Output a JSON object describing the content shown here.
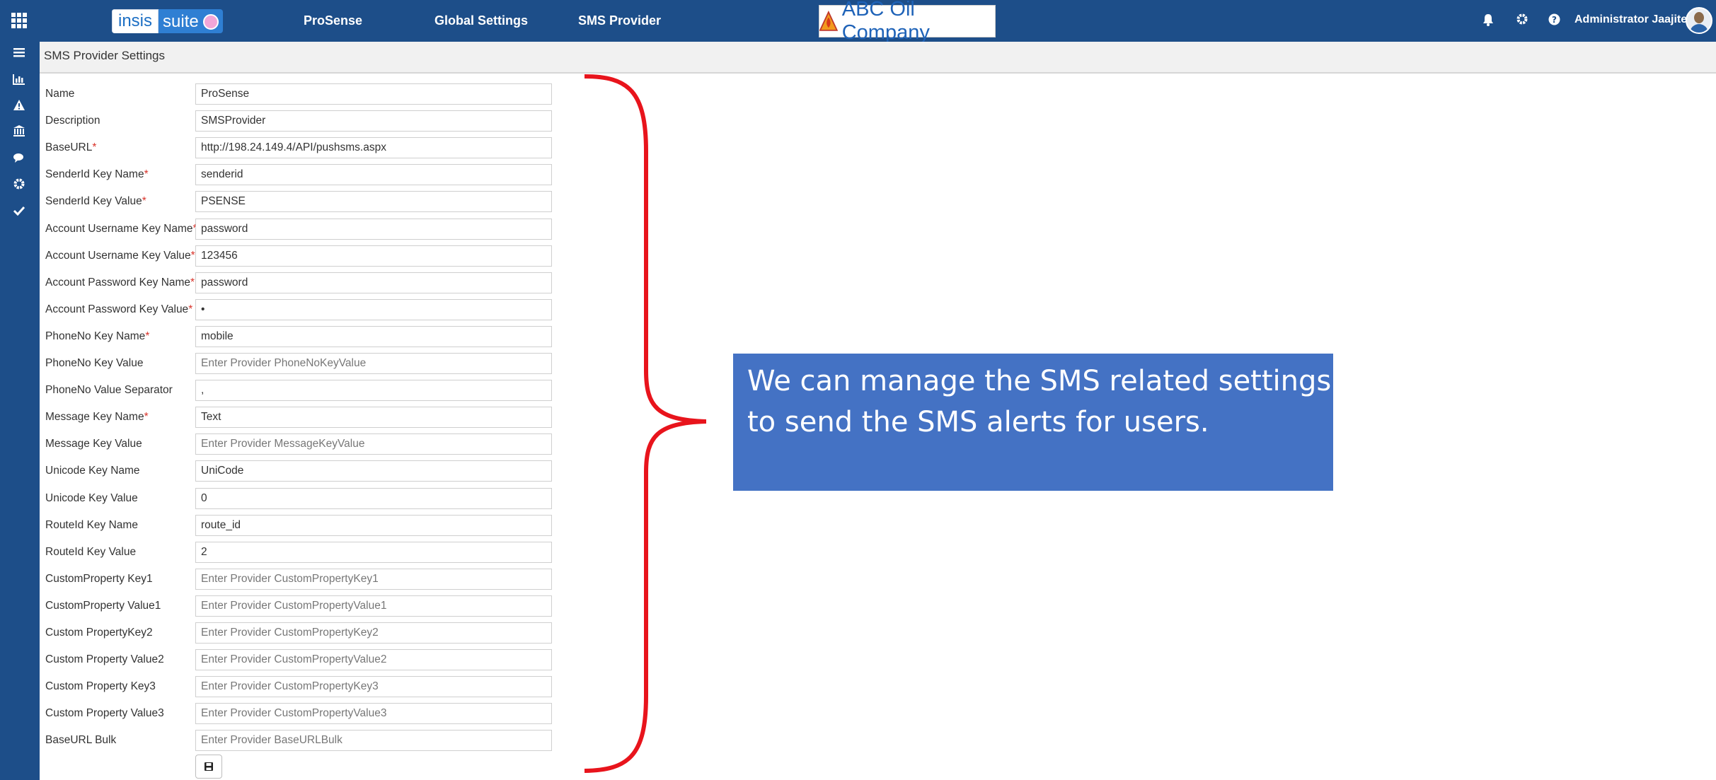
{
  "header": {
    "brand_left": "insis",
    "brand_right": "suite",
    "nav": [
      "ProSense",
      "Global Settings",
      "SMS Provider"
    ],
    "company": "ABC Oil Company",
    "user": "Administrator Jaajitech",
    "icons": [
      "grid-icon",
      "bell-icon",
      "gear-icon",
      "help-icon"
    ]
  },
  "sidebar": {
    "icons": [
      "menu-icon",
      "bar-chart-icon",
      "warning-icon",
      "bank-icon",
      "chat-icon",
      "gear-icon",
      "check-icon"
    ]
  },
  "page": {
    "title": "SMS Provider Settings"
  },
  "form": {
    "rows": [
      {
        "label": "Name",
        "required": false,
        "value": "ProSense",
        "placeholder": ""
      },
      {
        "label": "Description",
        "required": false,
        "value": "SMSProvider",
        "placeholder": ""
      },
      {
        "label": "BaseURL",
        "required": true,
        "value": "http://198.24.149.4/API/pushsms.aspx",
        "placeholder": ""
      },
      {
        "label": "SenderId Key Name",
        "required": true,
        "value": "senderid",
        "placeholder": ""
      },
      {
        "label": "SenderId Key Value",
        "required": true,
        "value": "PSENSE",
        "placeholder": ""
      },
      {
        "label": "Account Username Key Name",
        "required": true,
        "value": "password",
        "placeholder": ""
      },
      {
        "label": "Account Username Key Value",
        "required": true,
        "value": "123456",
        "placeholder": ""
      },
      {
        "label": "Account Password Key Name",
        "required": true,
        "value": "password",
        "placeholder": ""
      },
      {
        "label": "Account Password Key Value",
        "required": true,
        "value": "•",
        "placeholder": ""
      },
      {
        "label": "PhoneNo Key Name",
        "required": true,
        "value": "mobile",
        "placeholder": ""
      },
      {
        "label": "PhoneNo Key Value",
        "required": false,
        "value": "",
        "placeholder": "Enter Provider PhoneNoKeyValue"
      },
      {
        "label": "PhoneNo Value Separator",
        "required": false,
        "value": ",",
        "placeholder": ""
      },
      {
        "label": "Message Key Name",
        "required": true,
        "value": "Text",
        "placeholder": ""
      },
      {
        "label": "Message Key Value",
        "required": false,
        "value": "",
        "placeholder": "Enter Provider MessageKeyValue"
      },
      {
        "label": "Unicode Key Name",
        "required": false,
        "value": "UniCode",
        "placeholder": ""
      },
      {
        "label": "Unicode Key Value",
        "required": false,
        "value": "0",
        "placeholder": ""
      },
      {
        "label": "RouteId Key Name",
        "required": false,
        "value": "route_id",
        "placeholder": ""
      },
      {
        "label": "RouteId Key Value",
        "required": false,
        "value": "2",
        "placeholder": ""
      },
      {
        "label": "CustomProperty Key1",
        "required": false,
        "value": "",
        "placeholder": "Enter Provider CustomPropertyKey1"
      },
      {
        "label": "CustomProperty Value1",
        "required": false,
        "value": "",
        "placeholder": "Enter Provider CustomPropertyValue1"
      },
      {
        "label": "Custom PropertyKey2",
        "required": false,
        "value": "",
        "placeholder": "Enter Provider CustomPropertyKey2"
      },
      {
        "label": "Custom Property Value2",
        "required": false,
        "value": "",
        "placeholder": "Enter Provider CustomPropertyValue2"
      },
      {
        "label": "Custom Property Key3",
        "required": false,
        "value": "",
        "placeholder": "Enter Provider CustomPropertyKey3"
      },
      {
        "label": "Custom Property Value3",
        "required": false,
        "value": "",
        "placeholder": "Enter Provider CustomPropertyValue3"
      },
      {
        "label": "BaseURL Bulk",
        "required": false,
        "value": "",
        "placeholder": "Enter Provider BaseURLBulk"
      }
    ],
    "save_icon": "save-icon"
  },
  "annotation": {
    "text": "We can manage the SMS related  settings\nto send the SMS alerts for  users.",
    "box_color": "#4472c4",
    "brace_color": "#e8141c"
  },
  "colors": {
    "header_bg": "#1d4e89",
    "required": "#d9332a"
  }
}
